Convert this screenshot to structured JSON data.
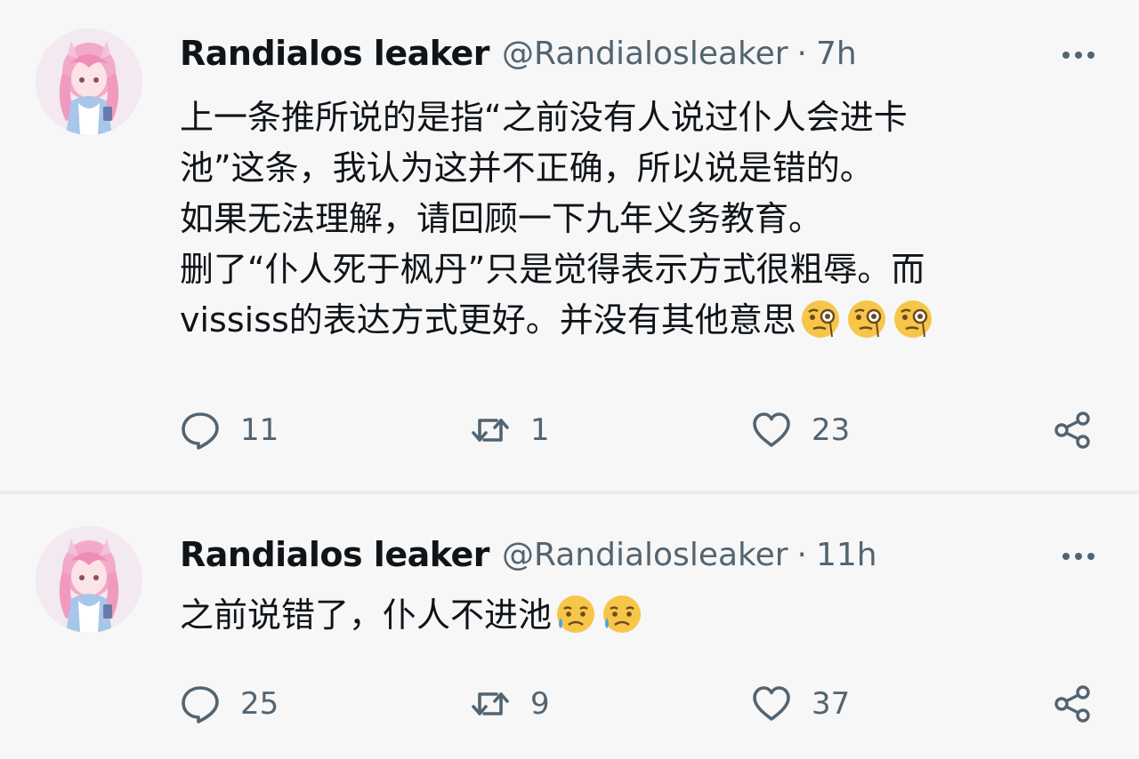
{
  "tweets": [
    {
      "author": {
        "display_name": "Randialos leaker",
        "handle": "@Randialosleaker",
        "avatar_icon": "anime-avatar"
      },
      "time": "7h",
      "separator": "·",
      "text_lines": [
        "上一条推所说的是指“之前没有人说过仆人会进卡",
        "池”这条，我认为这并不正确，所以说是错的。",
        "如果无法理解，请回顾一下九年义务教育。",
        "删了“仆人死于枫丹”只是觉得表示方式很粗辱。而",
        "vississ的表达方式更好。并没有其他意思"
      ],
      "emojis": [
        "face-with-monocle",
        "face-with-monocle",
        "face-with-monocle"
      ],
      "stats": {
        "replies": "11",
        "retweets": "1",
        "likes": "23"
      }
    },
    {
      "author": {
        "display_name": "Randialos leaker",
        "handle": "@Randialosleaker",
        "avatar_icon": "anime-avatar"
      },
      "time": "11h",
      "separator": "·",
      "text_lines": [
        "之前说错了，仆人不进池"
      ],
      "emojis": [
        "sad-but-relieved-face",
        "sad-but-relieved-face"
      ],
      "stats": {
        "replies": "25",
        "retweets": "9",
        "likes": "37"
      }
    }
  ],
  "icons": {
    "more": "more-dots-icon",
    "reply": "reply-icon",
    "retweet": "retweet-icon",
    "like": "heart-icon",
    "share": "share-icon"
  },
  "colors": {
    "background": "#f7f7f8",
    "text": "#0f1419",
    "secondary": "#536471"
  }
}
